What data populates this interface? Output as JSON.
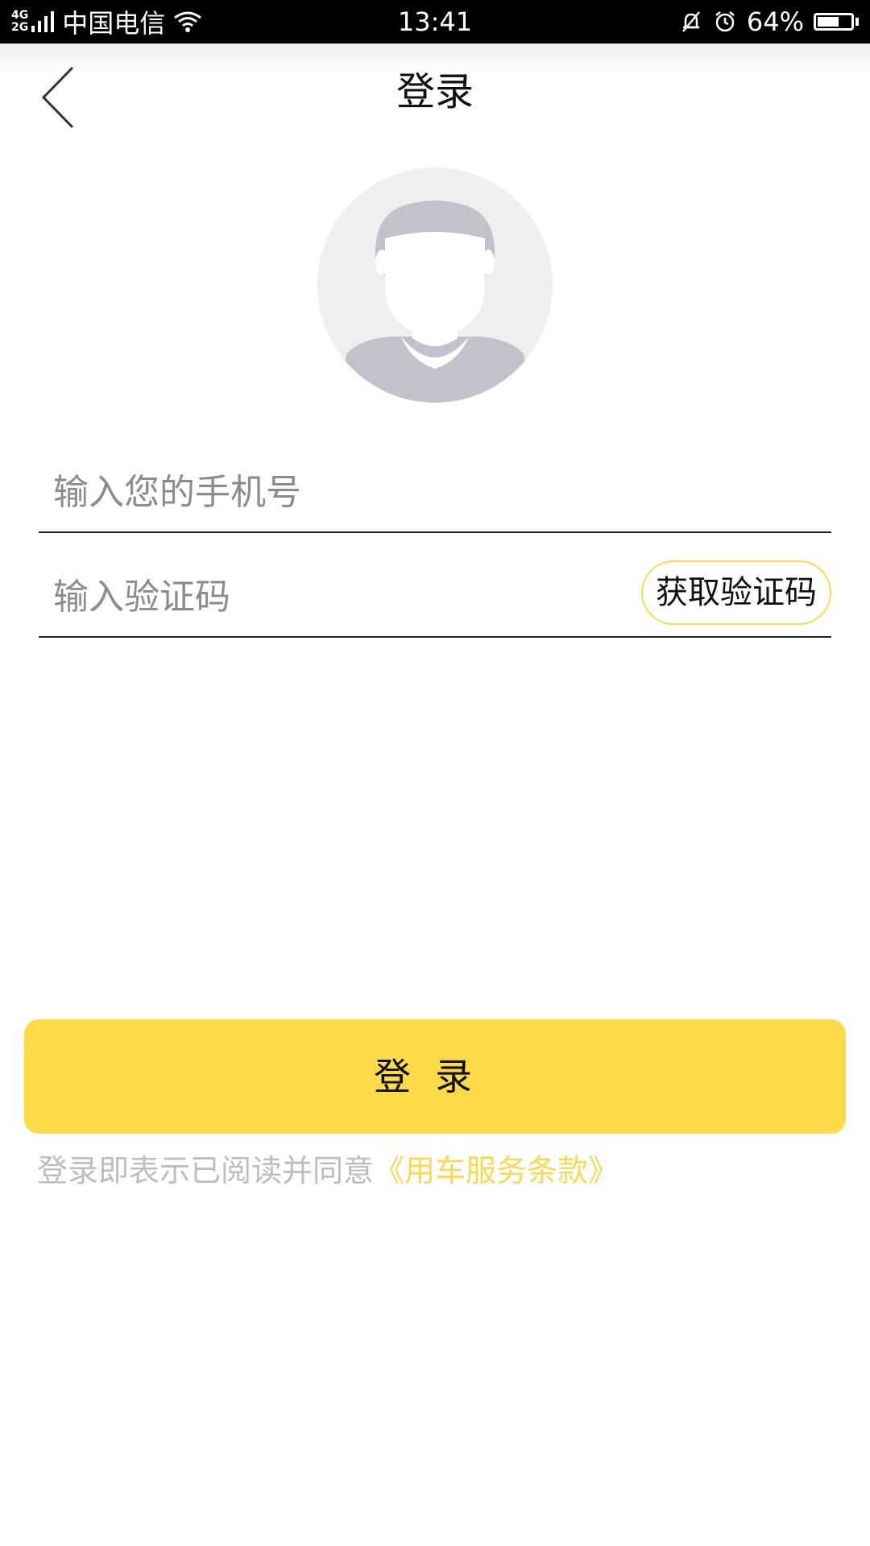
{
  "status_bar": {
    "network_top": "4G",
    "network_bottom": "2G",
    "carrier": "中国电信",
    "time": "13:41",
    "battery": "64%",
    "battery_level": 0.64
  },
  "nav": {
    "title": "登录",
    "back_icon": "chevron-left-icon"
  },
  "avatar": {
    "icon": "default-avatar"
  },
  "form": {
    "phone_placeholder": "输入您的手机号",
    "phone_value": "",
    "code_placeholder": "输入验证码",
    "code_value": "",
    "get_code_label": "获取验证码"
  },
  "login_button": {
    "label": "登录"
  },
  "agreement": {
    "text": "登录即表示已阅读并同意",
    "link": "《用车服务条款》"
  },
  "colors": {
    "accent": "#fddb48",
    "link": "#f6d955",
    "hint": "#bdbdbd"
  }
}
